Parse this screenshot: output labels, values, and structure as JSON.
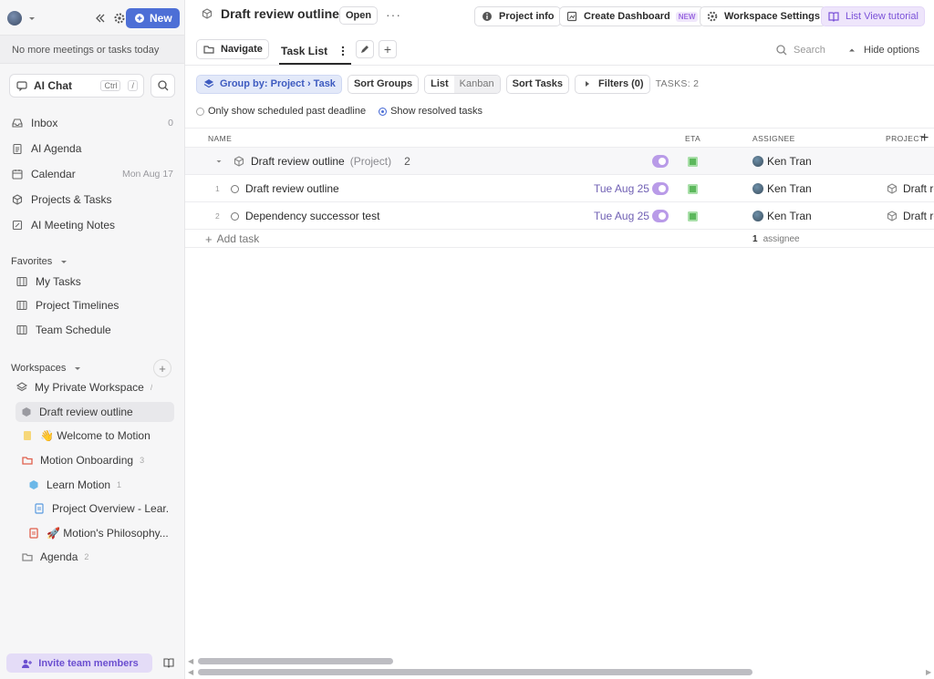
{
  "sidebar": {
    "new_label": "New",
    "status": "No more meetings or tasks today",
    "ai_chat": {
      "label": "AI Chat",
      "kbd1": "Ctrl",
      "kbd2": "/"
    },
    "nav": [
      {
        "label": "Inbox",
        "meta": "0",
        "icon": "inbox-icon"
      },
      {
        "label": "AI Agenda",
        "meta": "",
        "icon": "clipboard-icon"
      },
      {
        "label": "Calendar",
        "meta": "Mon Aug 17",
        "icon": "calendar-icon"
      },
      {
        "label": "Projects & Tasks",
        "meta": "",
        "icon": "cube-icon"
      },
      {
        "label": "AI Meeting Notes",
        "meta": "",
        "icon": "note-icon"
      }
    ],
    "favorites": {
      "title": "Favorites",
      "items": [
        "My Tasks",
        "Project Timelines",
        "Team Schedule"
      ]
    },
    "workspaces": {
      "title": "Workspaces",
      "items": [
        {
          "label": "My Private Workspace",
          "count": "/"
        },
        {
          "label": "Draft review outline",
          "count": ""
        },
        {
          "label": "👋 Welcome to Motion",
          "count": ""
        },
        {
          "label": "Motion Onboarding",
          "count": "3"
        },
        {
          "label": "Learn Motion",
          "count": "1"
        },
        {
          "label": "Project Overview - Lear...",
          "count": ""
        },
        {
          "label": "🚀 Motion's Philosophy...",
          "count": ""
        },
        {
          "label": "Agenda",
          "count": "2"
        }
      ]
    },
    "invite": "Invite team members"
  },
  "header": {
    "title": "Draft review outline",
    "open": "Open",
    "more": "···",
    "project_info": "Project info",
    "create_dashboard": "Create Dashboard",
    "new_tag": "NEW",
    "workspace_settings": "Workspace Settings",
    "tutorial": "List View tutorial"
  },
  "tabs": {
    "navigate": "Navigate",
    "task_list": "Task List",
    "search": "Search",
    "hide_options": "Hide options"
  },
  "toolbar": {
    "group_by": "Group by: Project › Task",
    "sort_groups": "Sort Groups",
    "view_list": "List",
    "view_kanban": "Kanban",
    "sort_tasks": "Sort Tasks",
    "filters": "Filters (0)",
    "task_count": "TASKS: 2",
    "only_scheduled": "Only show scheduled past deadline",
    "show_resolved": "Show resolved tasks"
  },
  "table": {
    "headers": {
      "name": "NAME",
      "eta": "ETA",
      "assignee": "ASSIGNEE",
      "project": "PROJECT"
    },
    "group": {
      "name": "Draft review outline",
      "suffix": "(Project)",
      "count": "2",
      "assignee": "Ken Tran"
    },
    "rows": [
      {
        "num": "1",
        "name": "Draft review outline",
        "date": "Tue Aug 25",
        "assignee": "Ken Tran",
        "project": "Draft re"
      },
      {
        "num": "2",
        "name": "Dependency successor test",
        "date": "Tue Aug 25",
        "assignee": "Ken Tran",
        "project": "Draft re"
      }
    ],
    "add_task": "Add task",
    "assignee_summary_count": "1",
    "assignee_summary_label": "assignee"
  },
  "colors": {
    "accent": "#4d6fd6",
    "purple": "#7b52d8",
    "eta_green": "#5cb85c"
  }
}
